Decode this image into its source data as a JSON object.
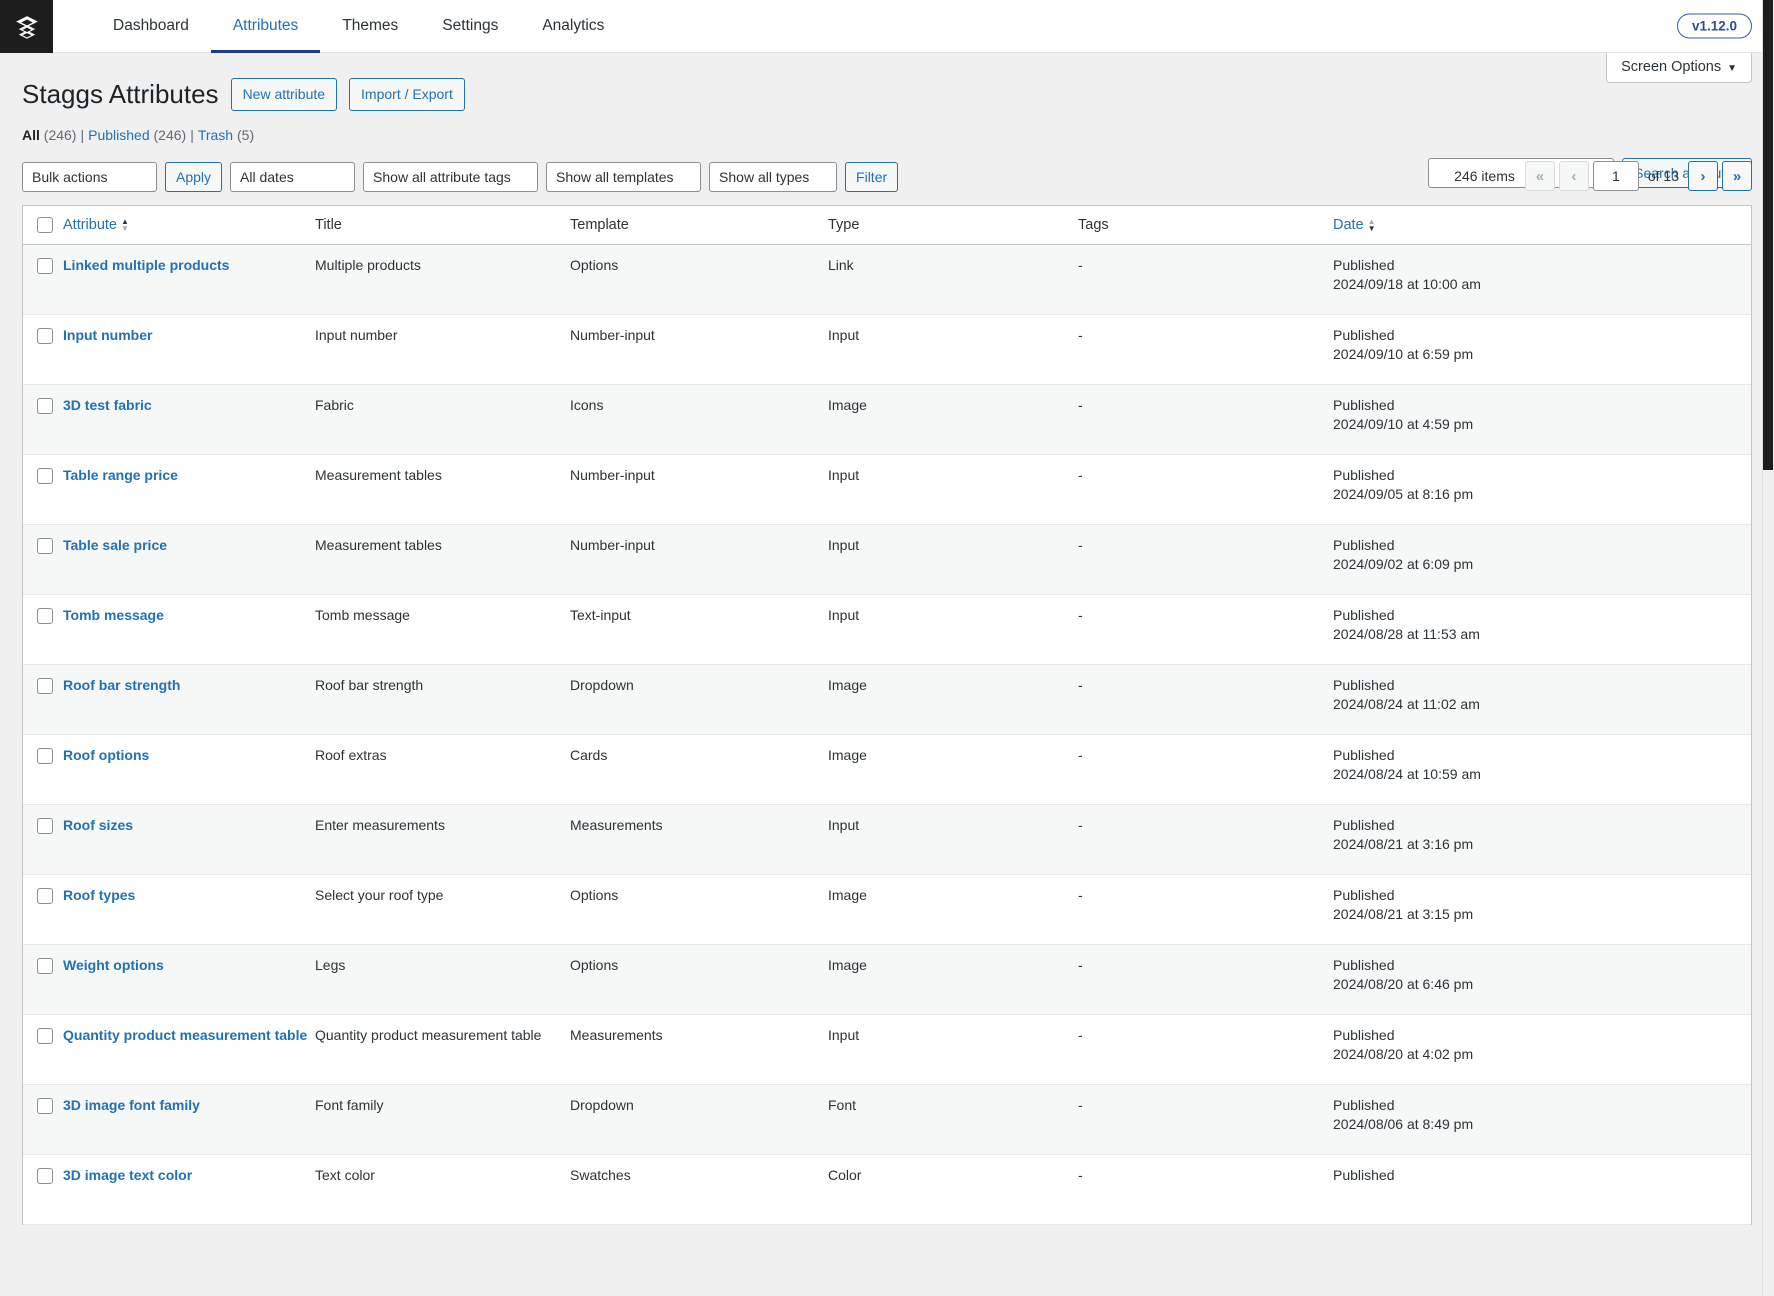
{
  "topbar": {
    "logo_icon": "layers-stack-icon",
    "nav": [
      {
        "label": "Dashboard",
        "active": false
      },
      {
        "label": "Attributes",
        "active": true
      },
      {
        "label": "Themes",
        "active": false
      },
      {
        "label": "Settings",
        "active": false
      },
      {
        "label": "Analytics",
        "active": false
      }
    ],
    "version": "v1.12.0"
  },
  "screen_options": {
    "label": "Screen Options",
    "caret": "▼"
  },
  "page": {
    "title": "Staggs Attributes",
    "new_attribute_label": "New attribute",
    "import_export_label": "Import / Export"
  },
  "views": {
    "all_label": "All",
    "all_count": "(246)",
    "published_label": "Published",
    "published_count": "(246)",
    "trash_label": "Trash",
    "trash_count": "(5)",
    "separator": "|"
  },
  "search": {
    "value": "",
    "placeholder": "",
    "button_label": "Search attributes"
  },
  "filters": {
    "bulk_actions": "Bulk actions",
    "apply_label": "Apply",
    "all_dates": "All dates",
    "attribute_tags": "Show all attribute tags",
    "templates": "Show all templates",
    "types": "Show all types",
    "filter_label": "Filter",
    "arrow": "⌄"
  },
  "pagination": {
    "items_label": "246 items",
    "first": "«",
    "prev": "‹",
    "current_page": "1",
    "of_total": "of 13",
    "next": "›",
    "last": "»"
  },
  "table": {
    "columns": {
      "attribute": "Attribute",
      "title": "Title",
      "template": "Template",
      "type": "Type",
      "tags": "Tags",
      "date": "Date"
    },
    "rows": [
      {
        "attribute": "Linked multiple products",
        "title": "Multiple products",
        "template": "Options",
        "type": "Link",
        "tags": "-",
        "status": "Published",
        "date": "2024/09/18 at 10:00 am"
      },
      {
        "attribute": "Input number",
        "title": "Input number",
        "template": "Number-input",
        "type": "Input",
        "tags": "-",
        "status": "Published",
        "date": "2024/09/10 at 6:59 pm"
      },
      {
        "attribute": "3D test fabric",
        "title": "Fabric",
        "template": "Icons",
        "type": "Image",
        "tags": "-",
        "status": "Published",
        "date": "2024/09/10 at 4:59 pm"
      },
      {
        "attribute": "Table range price",
        "title": "Measurement tables",
        "template": "Number-input",
        "type": "Input",
        "tags": "-",
        "status": "Published",
        "date": "2024/09/05 at 8:16 pm"
      },
      {
        "attribute": "Table sale price",
        "title": "Measurement tables",
        "template": "Number-input",
        "type": "Input",
        "tags": "-",
        "status": "Published",
        "date": "2024/09/02 at 6:09 pm"
      },
      {
        "attribute": "Tomb message",
        "title": "Tomb message",
        "template": "Text-input",
        "type": "Input",
        "tags": "-",
        "status": "Published",
        "date": "2024/08/28 at 11:53 am"
      },
      {
        "attribute": "Roof bar strength",
        "title": "Roof bar strength",
        "template": "Dropdown",
        "type": "Image",
        "tags": "-",
        "status": "Published",
        "date": "2024/08/24 at 11:02 am"
      },
      {
        "attribute": "Roof options",
        "title": "Roof extras",
        "template": "Cards",
        "type": "Image",
        "tags": "-",
        "status": "Published",
        "date": "2024/08/24 at 10:59 am"
      },
      {
        "attribute": "Roof sizes",
        "title": "Enter measurements",
        "template": "Measurements",
        "type": "Input",
        "tags": "-",
        "status": "Published",
        "date": "2024/08/21 at 3:16 pm"
      },
      {
        "attribute": "Roof types",
        "title": "Select your roof type",
        "template": "Options",
        "type": "Image",
        "tags": "-",
        "status": "Published",
        "date": "2024/08/21 at 3:15 pm"
      },
      {
        "attribute": "Weight options",
        "title": "Legs",
        "template": "Options",
        "type": "Image",
        "tags": "-",
        "status": "Published",
        "date": "2024/08/20 at 6:46 pm"
      },
      {
        "attribute": "Quantity product measurement table",
        "title": "Quantity product measurement table",
        "template": "Measurements",
        "type": "Input",
        "tags": "-",
        "status": "Published",
        "date": "2024/08/20 at 4:02 pm"
      },
      {
        "attribute": "3D image font family",
        "title": "Font family",
        "template": "Dropdown",
        "type": "Font",
        "tags": "-",
        "status": "Published",
        "date": "2024/08/06 at 8:49 pm"
      },
      {
        "attribute": "3D image text color",
        "title": "Text color",
        "template": "Swatches",
        "type": "Color",
        "tags": "-",
        "status": "Published",
        "date": ""
      }
    ]
  },
  "colors": {
    "link": "#2271b1",
    "accent": "#1d3f8a",
    "sidebar_bg": "#1d1d1d",
    "page_bg": "#f0f0f1",
    "alt_row": "#f6f7f7"
  }
}
